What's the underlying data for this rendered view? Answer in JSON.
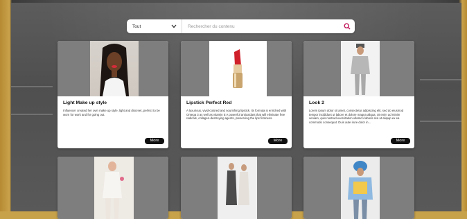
{
  "search": {
    "category": "Tout",
    "placeholder": "Rechercher du contenu"
  },
  "colors": {
    "accent": "#c2185b"
  },
  "cards": [
    {
      "title": "Light Make up style",
      "description": "Influencer created her own make up style, light and discreet, perfect to be worn for work and for going out.",
      "more": "More"
    },
    {
      "title": "Lipstick Perfect Red",
      "description": "A luxurious, vivid-colored and nourishing lipstick. Its formula is enriched with Omega 3 as well as vitamin E A powerful antioxidant that will eliminate free radicals, collagen-destroying agents, preserving the lips firmness.",
      "more": "More"
    },
    {
      "title": "Look 2",
      "description": "Lorem ipsum dolor sit amet, consectetur adipiscing elit, sed do eiusmod tempor incididunt ut labore et dolore magna aliqua. Ut enim ad minim veniam, quis nostrud exercitation ullamco laboris nisi ut aliquip ex ea commodo consequat. Duis aute irure dolor in...",
      "more": "More"
    }
  ],
  "icons": {
    "dropdown": "chevron-down-icon",
    "search": "search-icon"
  }
}
